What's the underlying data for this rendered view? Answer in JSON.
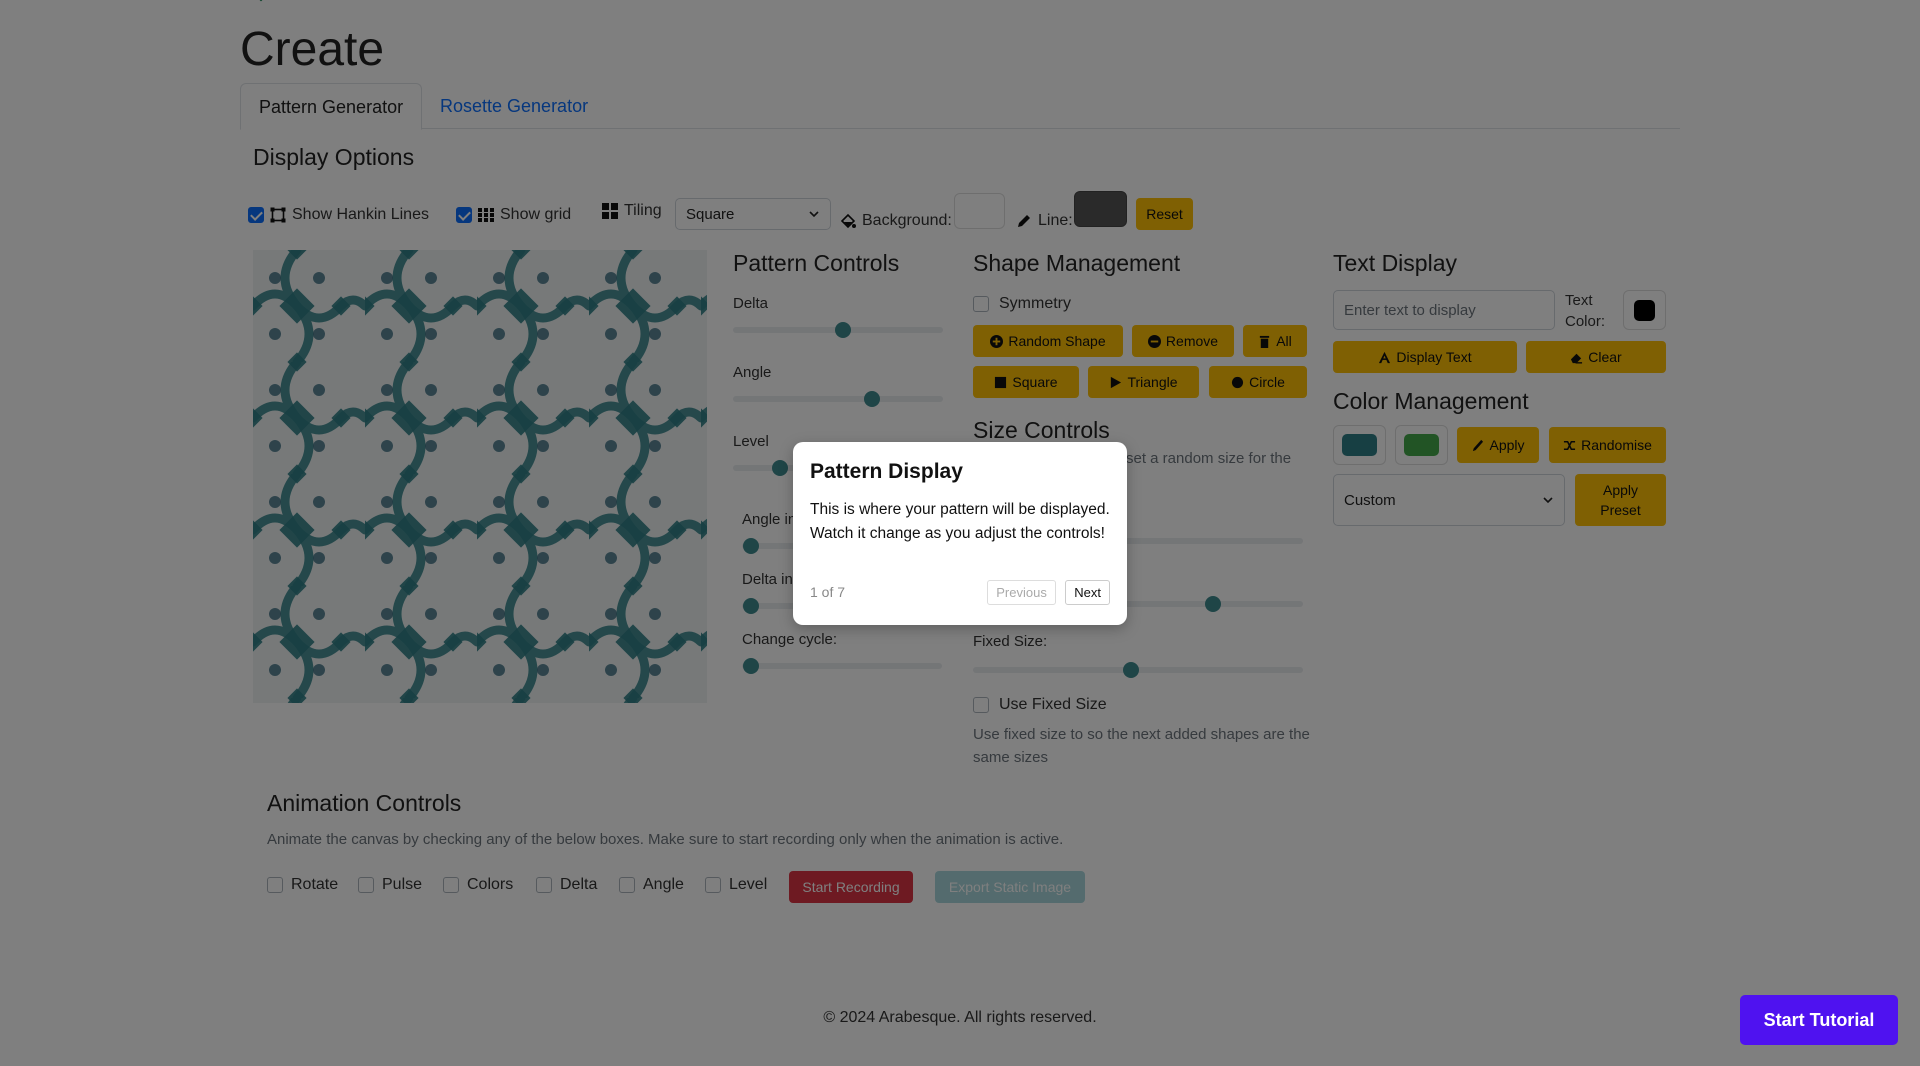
{
  "page": {
    "title": "Create"
  },
  "tabs": [
    {
      "label": "Pattern Generator",
      "active": true
    },
    {
      "label": "Rosette Generator",
      "active": false
    }
  ],
  "display_options": {
    "title": "Display Options",
    "show_hankin_lines": {
      "label": "Show Hankin Lines",
      "checked": true
    },
    "show_grid": {
      "label": "Show grid",
      "checked": true
    },
    "tiling": {
      "label": "Tiling",
      "value": "Square"
    },
    "background_label": "Background:",
    "line_label": "Line:",
    "reset_label": "Reset",
    "background_color": "#ffffff",
    "line_color": "#555555"
  },
  "pattern_controls": {
    "title": "Pattern Controls",
    "delta": {
      "label": "Delta",
      "value": 0.53
    },
    "angle": {
      "label": "Angle",
      "value": 0.73
    },
    "level": {
      "label": "Level",
      "value": 0.2
    },
    "angle_increment": {
      "label": "Angle in",
      "value": 0.05
    },
    "delta_increment": {
      "label": "Delta in",
      "value": 0.05
    },
    "change_cycle": {
      "label": "Change cycle:",
      "value": 0.05
    }
  },
  "shape_management": {
    "title": "Shape Management",
    "symmetry": {
      "label": "Symmetry",
      "checked": false
    },
    "random_shape_label": "Random Shape",
    "remove_label": "Remove",
    "all_label": "All",
    "square_label": "Square",
    "triangle_label": "Triangle",
    "circle_label": "Circle"
  },
  "size_controls": {
    "title": "Size Controls",
    "hint_partial": "set a random size for the",
    "slider2_value": 0.73,
    "fixed_size": {
      "label": "Fixed Size:",
      "value": 0.47
    },
    "use_fixed_size": {
      "label": "Use Fixed Size",
      "checked": false
    },
    "help": "Use fixed size to so the next added shapes are the same sizes"
  },
  "text_display": {
    "title": "Text Display",
    "placeholder": "Enter text to display",
    "text_color_label": "Text Color:",
    "text_color": "#000000",
    "display_text_label": "Display Text",
    "clear_label": "Clear"
  },
  "color_management": {
    "title": "Color Management",
    "color1": "#2f7f86",
    "color2": "#44a94b",
    "apply_label": "Apply",
    "randomise_label": "Randomise",
    "preset_value": "Custom",
    "apply_preset_label": "Apply Preset"
  },
  "animation_controls": {
    "title": "Animation Controls",
    "description": "Animate the canvas by checking any of the below boxes. Make sure to start recording only when the animation is active.",
    "options": [
      {
        "label": "Rotate",
        "checked": false
      },
      {
        "label": "Pulse",
        "checked": false
      },
      {
        "label": "Colors",
        "checked": false
      },
      {
        "label": "Delta",
        "checked": false
      },
      {
        "label": "Angle",
        "checked": false
      },
      {
        "label": "Level",
        "checked": false
      }
    ],
    "start_recording_label": "Start Recording",
    "export_label": "Export Static Image"
  },
  "footer": {
    "text": "© 2024 Arabesque. All rights reserved."
  },
  "tutorial": {
    "title": "Pattern Display",
    "body": "This is where your pattern will be displayed. Watch it change as you adjust the controls!",
    "progress": "1 of 7",
    "previous_label": "Previous",
    "next_label": "Next"
  },
  "start_tutorial_label": "Start Tutorial"
}
